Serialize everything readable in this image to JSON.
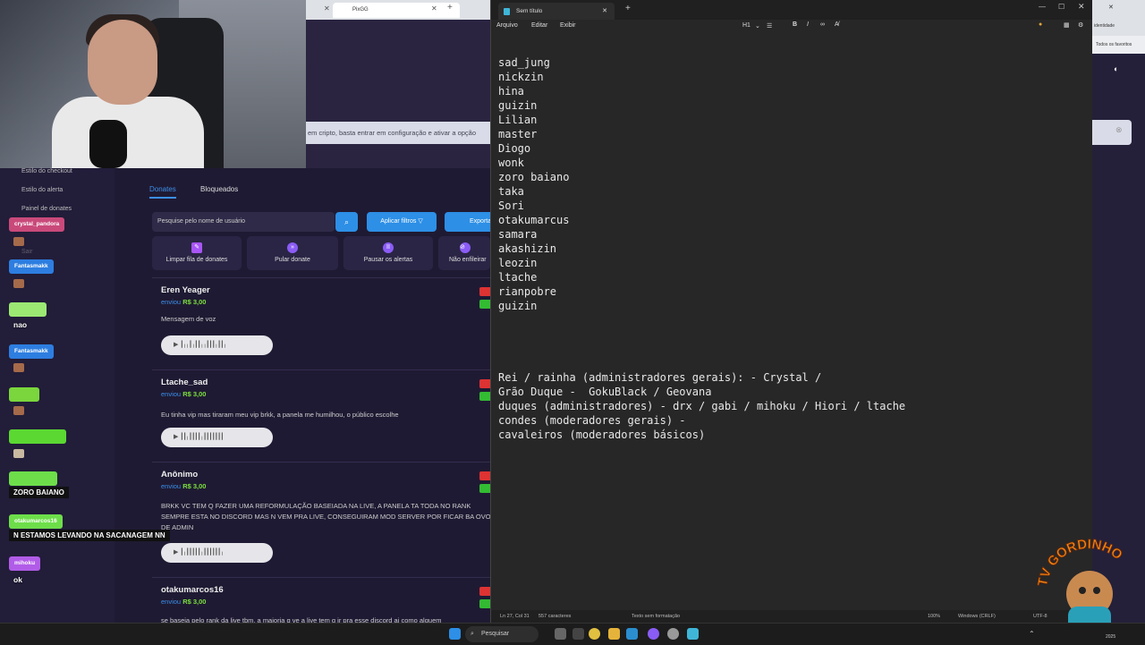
{
  "browser": {
    "tab_label": "PixGG",
    "banner": "em cripto, basta entrar em configuração e ativar a opção"
  },
  "site_nav": {
    "items": [
      "Estilo do checkout",
      "Estilo do alerta",
      "Painel de donates",
      "Sair"
    ]
  },
  "site": {
    "tabs": [
      "Donates",
      "Bloqueados"
    ],
    "search_placeholder": "Pesquise pelo nome de usuário",
    "filter_label": "Aplicar filtros",
    "export_label": "Exportar",
    "actions": [
      "Limpar fila de donates",
      "Pular donate",
      "Pausar os alertas",
      "Não enfileirar"
    ],
    "donates": [
      {
        "name": "Eren Yeager",
        "sent": "enviou",
        "amount": "R$ 3,00",
        "message": "Mensagem de voz"
      },
      {
        "name": "Ltache_sad",
        "sent": "enviou",
        "amount": "R$ 3,00",
        "message": "Eu tinha vip mas tiraram meu vip brkk, a panela me humilhou, o público escolhe"
      },
      {
        "name": "Anônimo",
        "sent": "enviou",
        "amount": "R$ 3,00",
        "message": "BRKK VC TEM Q FAZER UMA REFORMULAÇÃO BASEIADA NA LIVE, A PANELA TA TODA NO RANK SEMPRE ESTA NO DISCORD MAS N VEM PRA LIVE, CONSEGUIRAM MOD SERVER POR FICAR BA OVO DE ADMIN"
      },
      {
        "name": "otakumarcos16",
        "sent": "enviou",
        "amount": "R$ 3,00",
        "message": "se baseia pelo rank da live tbm, a maioria q ve a live tem q ir pra esse discord ai como alguem"
      }
    ]
  },
  "chat": [
    {
      "user": "crystal_pandora",
      "msg": ""
    },
    {
      "user": "Fantasmakk",
      "msg": ""
    },
    {
      "user": "",
      "msg": "nao"
    },
    {
      "user": "Fantasmakk",
      "msg": ""
    },
    {
      "user": "",
      "msg": ""
    },
    {
      "user": "",
      "msg": ""
    },
    {
      "user": "",
      "msg": "ZORO BAIANO"
    },
    {
      "user": "otakumarcos16",
      "msg": "N ESTAMOS LEVANDO NA SACANAGEM NN"
    },
    {
      "user": "mihoku",
      "msg": "ok"
    }
  ],
  "notepad": {
    "tab_title": "Sem título",
    "menu": [
      "Arquivo",
      "Editar",
      "Exibir"
    ],
    "heading_control": "H1",
    "lines": [
      "sad_jung",
      "nickzin",
      "hina",
      "guizin",
      "Lilian",
      "master",
      "Diogo",
      "wonk",
      "zoro baiano",
      "taka",
      "Sori",
      "otakumarcus",
      "samara",
      "akashizin",
      "leozin",
      "ltache",
      "rianpobre",
      "guizin",
      "",
      "",
      "",
      "",
      "Rei / rainha (administradores gerais): - Crystal /",
      "Grão Duque -  GokuBlack / Geovana",
      "duques (administradores) - drx / gabi / mihoku / Hiori / ltache",
      "condes (moderadores gerais) -",
      "cavaleiros (moderadores básicos)"
    ],
    "status": {
      "position": "Ln 27, Col 31",
      "chars": "557 caracteres",
      "format": "Texto sem formatação",
      "zoom": "100%",
      "eol": "Windows (CRLF)",
      "encoding": "UTF-8"
    }
  },
  "right_panel": {
    "label1": "identidade",
    "label2": "Todos os favoritos"
  },
  "taskbar": {
    "search": "Pesquisar",
    "date": "2025"
  },
  "logo": {
    "text": "TV GORDINHO"
  }
}
